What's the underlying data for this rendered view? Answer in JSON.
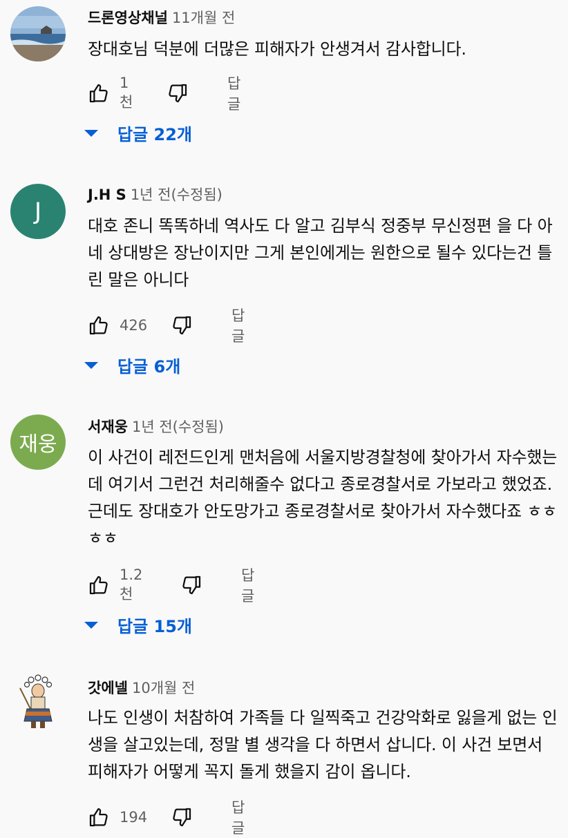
{
  "comments": [
    {
      "author": "드론영상채널",
      "time": "11개월 전",
      "text": "장대호님 덕분에 더많은 피해자가 안생겨서 감사합니다.",
      "likes": "1천",
      "reply_label": "답글",
      "replies_label": "답글 22개",
      "avatar_type": "photo-sea"
    },
    {
      "author": "J.H S",
      "time": "1년 전(수정됨)",
      "text": "대호 존니 똑똑하네 역사도 다 알고 김부식  정중부 무신정편 을 다 아네 상대방은 장난이지만 그게 본인에게는 원한으로 될수 있다는건 틀린 말은 아니다",
      "likes": "426",
      "reply_label": "답글",
      "replies_label": "답글 6개",
      "avatar_letter": "J",
      "avatar_color": "#2a8371"
    },
    {
      "author": "서재웅",
      "time": "1년 전(수정됨)",
      "text": "이 사건이 레전드인게 맨처음에 서울지방경찰청에 찾아가서 자수했는데 여기서 그런건 처리해줄수 없다고 종로경찰서로 가보라고 했었죠.근데도 장대호가 안도망가고 종로경찰서로 찾아가서 자수했다죠 ㅎㅎㅎㅎ",
      "likes": "1.2천",
      "reply_label": "답글",
      "replies_label": "답글 15개",
      "avatar_letter": "재웅",
      "avatar_color": "#7cab4f"
    },
    {
      "author": "갓에넬",
      "time": "10개월 전",
      "text": "나도 인생이 처참하여 가족들 다 일찍죽고 건강악화로 잃을게 없는 인생을 살고있는데, 정말 별 생각을 다 하면서 삽니다. 이 사건 보면서 피해자가 어떻게 꼭지 돌게 했을지 감이 옵니다.",
      "likes": "194",
      "reply_label": "답글",
      "avatar_type": "character-illustration"
    }
  ],
  "colors": {
    "background": "#f9f9f9",
    "text": "#0f0f0f",
    "secondary": "#606060",
    "link": "#065fd4"
  },
  "icons": {
    "like": "thumbs-up-outline",
    "dislike": "thumbs-down-outline",
    "expand": "triangle-down"
  }
}
